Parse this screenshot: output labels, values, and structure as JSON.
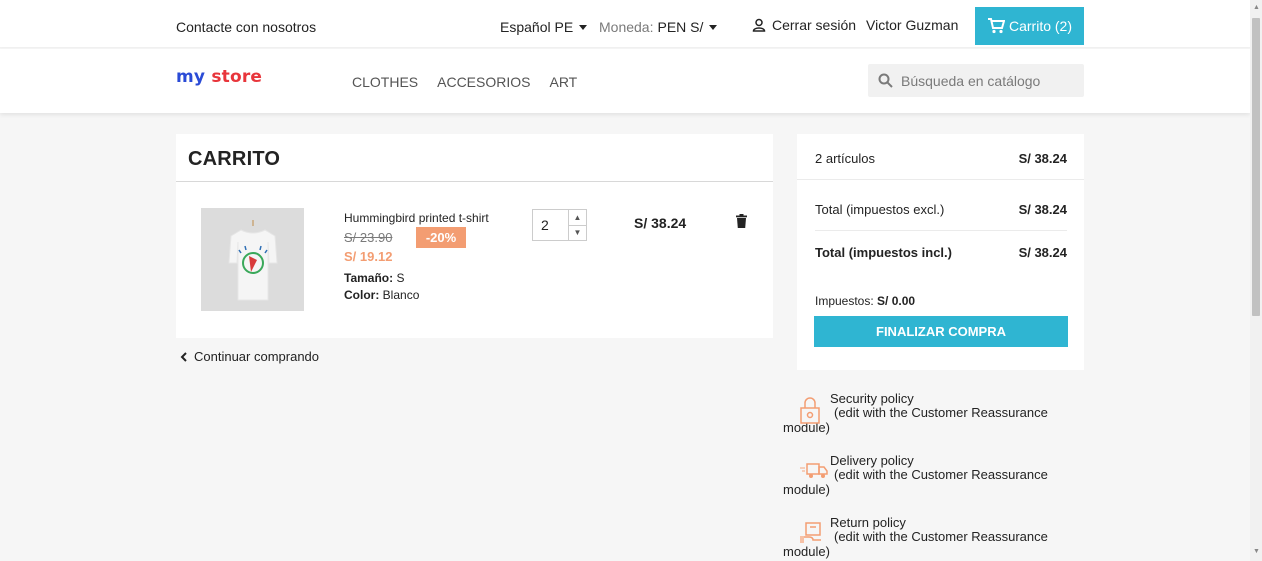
{
  "topbar": {
    "contact": "Contacte con nosotros",
    "language": "Español PE",
    "currency_label": "Moneda:",
    "currency_value": "PEN S/",
    "logout": "Cerrar sesión",
    "username": "Victor Guzman",
    "cart": "Carrito (2)"
  },
  "header": {
    "logo_my": "my",
    "logo_store": "store",
    "menu": [
      "CLOTHES",
      "ACCESORIOS",
      "ART"
    ],
    "search_placeholder": "Búsqueda en catálogo"
  },
  "cart": {
    "title": "CARRITO",
    "item": {
      "name": "Hummingbird printed t-shirt",
      "old_price": "S/ 23.90",
      "discount": "-20%",
      "price": "S/ 19.12",
      "size_label": "Tamaño:",
      "size_value": "S",
      "color_label": "Color:",
      "color_value": "Blanco",
      "quantity": "2",
      "line_total": "S/ 38.24"
    },
    "continue": "Continuar comprando"
  },
  "summary": {
    "items_label": "2 artículos",
    "items_value": "S/ 38.24",
    "total_excl_label": "Total (impuestos excl.)",
    "total_excl_value": "S/ 38.24",
    "total_incl_label": "Total (impuestos incl.)",
    "total_incl_value": "S/ 38.24",
    "tax_label": "Impuestos:",
    "tax_value": "S/ 0.00",
    "checkout": "FINALIZAR COMPRA"
  },
  "reassurance": [
    {
      "title": "Security policy",
      "line2": "(edit with the Customer Reassurance",
      "line3": "module)"
    },
    {
      "title": "Delivery policy",
      "line2": "(edit with the Customer Reassurance",
      "line3": "module)"
    },
    {
      "title": "Return policy",
      "line2": "(edit with the Customer Reassurance",
      "line3": "module)"
    }
  ],
  "colors": {
    "accent": "#2fb5d2",
    "discount": "#f39d72",
    "logo_my": "#2a4bd6",
    "logo_store": "#e8353b"
  }
}
